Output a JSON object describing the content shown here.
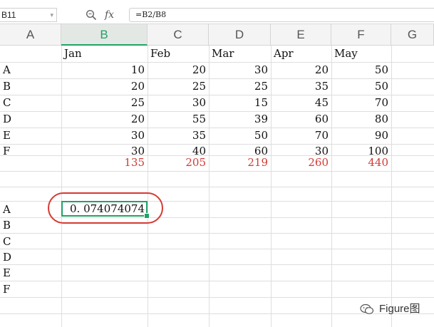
{
  "toolbar": {
    "name_box": "B11",
    "fx_label": "fx",
    "formula": "=B2/B8"
  },
  "columns": [
    "A",
    "B",
    "C",
    "D",
    "E",
    "F",
    "G"
  ],
  "headers": [
    "Jan",
    "Feb",
    "Mar",
    "Apr",
    "May"
  ],
  "rows": [
    {
      "label": "A",
      "values": [
        "10",
        "20",
        "30",
        "20",
        "50"
      ]
    },
    {
      "label": "B",
      "values": [
        "20",
        "25",
        "25",
        "35",
        "50"
      ]
    },
    {
      "label": "C",
      "values": [
        "25",
        "30",
        "15",
        "45",
        "70"
      ]
    },
    {
      "label": "D",
      "values": [
        "20",
        "55",
        "39",
        "60",
        "80"
      ]
    },
    {
      "label": "E",
      "values": [
        "30",
        "35",
        "50",
        "70",
        "90"
      ]
    },
    {
      "label": "F",
      "values": [
        "30",
        "40",
        "60",
        "30",
        "100"
      ]
    }
  ],
  "totals": [
    "135",
    "205",
    "219",
    "260",
    "440"
  ],
  "lower_labels": [
    "A",
    "B",
    "C",
    "D",
    "E",
    "F"
  ],
  "result_value": "0. 074074074",
  "watermark": "Figure图",
  "colors": {
    "accent": "#21a366",
    "highlight": "#d43a34"
  }
}
